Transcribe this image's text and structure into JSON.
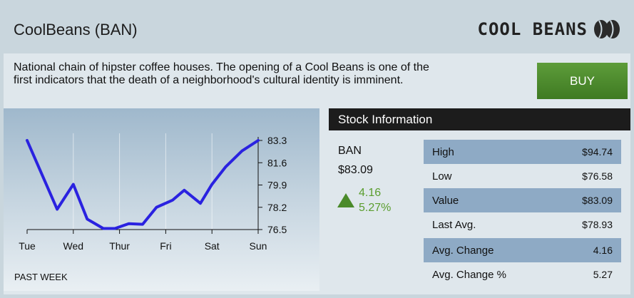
{
  "header": {
    "title": "CoolBeans (BAN)",
    "logo_text": "COOL BEANS",
    "logo_icon": "coffee-beans-icon"
  },
  "description": "National chain of hipster coffee houses. The opening of a Cool Beans is one of the first indicators that the death of a neighborhood's cultural identity is imminent.",
  "buy_label": "BUY",
  "colors": {
    "buy_button": "#4a8a2a",
    "line": "#2a22e0",
    "change_positive": "#5a9d2e",
    "row_shade": "#8eaac5"
  },
  "chart_caption": "PAST WEEK",
  "chart_data": {
    "type": "line",
    "x_tick_labels": [
      "Tue",
      "Wed",
      "Thur",
      "Fri",
      "Sat",
      "Sun"
    ],
    "y_tick_labels": [
      "83.3",
      "81.6",
      "79.9",
      "78.2",
      "76.5"
    ],
    "ylim": [
      76.5,
      83.3
    ],
    "y_axis_side": "right",
    "grid": "vertical",
    "series": [
      {
        "x": [
          0,
          0.65,
          1,
          1.3,
          1.65,
          1.9,
          2.2,
          2.5,
          2.8,
          3.15,
          3.4,
          3.75,
          4,
          4.3,
          4.65,
          5
        ],
        "values": [
          83.3,
          78.05,
          79.95,
          77.3,
          76.58,
          76.58,
          76.95,
          76.9,
          78.2,
          78.75,
          79.5,
          78.5,
          79.95,
          81.3,
          82.5,
          83.3
        ]
      }
    ]
  },
  "stock_info": {
    "heading": "Stock Information",
    "symbol": "BAN",
    "price": "$83.09",
    "change": "4.16",
    "change_pct": "5.27%",
    "rows": [
      {
        "label": "High",
        "value": "$94.74"
      },
      {
        "label": "Low",
        "value": "$76.58"
      },
      {
        "label": "Value",
        "value": "$83.09"
      },
      {
        "label": "Last Avg.",
        "value": "$78.93"
      },
      {
        "label": "Avg. Change",
        "value": "4.16"
      },
      {
        "label": "Avg. Change %",
        "value": "5.27"
      }
    ]
  }
}
